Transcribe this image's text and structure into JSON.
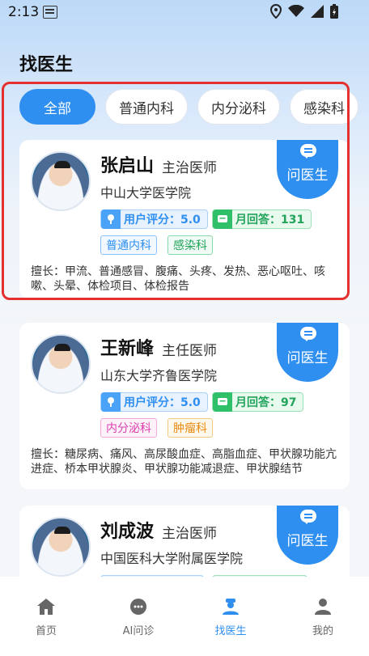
{
  "status_bar": {
    "time": "2:13"
  },
  "page_title": "找医生",
  "filters": [
    {
      "label": "全部",
      "active": true
    },
    {
      "label": "普通内科",
      "active": false
    },
    {
      "label": "内分泌科",
      "active": false
    },
    {
      "label": "感染科",
      "active": false
    }
  ],
  "doctors": [
    {
      "name": "张启山",
      "rank": "主治医师",
      "hospital": "中山大学医学院",
      "rating_label": "用户评分：5.0",
      "reply_label": "月回答：131",
      "tags": [
        "普通内科",
        "感染科"
      ],
      "specialty": "擅长：甲流、普通感冒、腹痛、头疼、发热、恶心呕吐、咳嗽、头晕、体检项目、体检报告",
      "ask_label": "问医生"
    },
    {
      "name": "王新峰",
      "rank": "主任医师",
      "hospital": "山东大学齐鲁医学院",
      "rating_label": "用户评分：5.0",
      "reply_label": "月回答：97",
      "tags": [
        "内分泌科",
        "肿瘤科"
      ],
      "specialty": "擅长：糖尿病、痛风、高尿酸血症、高脂血症、甲状腺功能亢进症、桥本甲状腺炎、甲状腺功能减退症、甲状腺结节",
      "ask_label": "问医生"
    },
    {
      "name": "刘成波",
      "rank": "主治医师",
      "hospital": "中国医科大学附属医学院",
      "ask_label": "问医生"
    }
  ],
  "nav": [
    {
      "label": "首页",
      "icon": "home-icon"
    },
    {
      "label": "AI问诊",
      "icon": "ai-chat-icon"
    },
    {
      "label": "找医生",
      "icon": "doctor-icon",
      "active": true
    },
    {
      "label": "我的",
      "icon": "profile-icon"
    }
  ],
  "colors": {
    "accent": "#2f8ff0",
    "highlight": "#e53030"
  }
}
